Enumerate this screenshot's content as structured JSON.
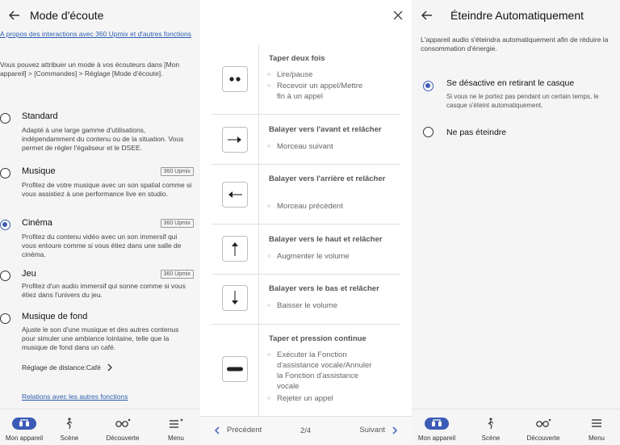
{
  "left": {
    "title": "Mode d'écoute",
    "about_link": "A propos des interactions avec 360 Upmix et d'autres fonctions",
    "intro": "Vous pouvez attribuer un mode à vos écouteurs dans [Mon appareil] > [Commandes] > Réglage [Mode d'écoute].",
    "options": [
      {
        "name": "Standard",
        "desc": "Adapté à une large gamme d'utilisations, indépendamment du contenu ou de la situation. Vous permet de régler l'égaliseur et le DSEE.",
        "badge": "",
        "selected": false
      },
      {
        "name": "Musique",
        "desc": "Profitez de votre musique avec un son spatial comme si vous assistiez à une performance live en studio.",
        "badge": "360 Upmix",
        "selected": false
      },
      {
        "name": "Cinéma",
        "desc": "Profitez du contenu vidéo avec un son immersif qui vous entoure comme si vous étiez dans une salle de cinéma.",
        "badge": "360 Upmix",
        "selected": true
      },
      {
        "name": "Jeu",
        "desc": "Profitez d'un audio immersif qui sonne comme si vous étiez dans l'univers du jeu.",
        "badge": "360 Upmix",
        "selected": false
      },
      {
        "name": "Musique de fond",
        "desc": "Ajuste le son d'une musique et des autres contenus pour simuler une ambiance lointaine, telle que la musique de fond dans un café.",
        "badge": "",
        "selected": false
      }
    ],
    "distance_setting": "Réglage de distance:Café",
    "relations_link": "Relations avec les autres fonctions"
  },
  "nav": {
    "my_device": "Mon appareil",
    "scene": "Scène",
    "discovery": "Découverte",
    "menu": "Menu"
  },
  "mid": {
    "gestures": [
      {
        "title": "Taper deux fois",
        "icon": "double-tap-icon",
        "actions": [
          "Lire/pause",
          "Recevoir un appel/Mettre fin à un appel"
        ]
      },
      {
        "title": "Balayer vers l'avant et relâcher",
        "icon": "swipe-forward-icon",
        "actions": [
          "Morceau suivant"
        ]
      },
      {
        "title": "Balayer vers l'arrière et relâcher",
        "icon": "swipe-backward-icon",
        "actions": [
          "Morceau précédent"
        ]
      },
      {
        "title": "Balayer vers le haut et relâcher",
        "icon": "swipe-up-icon",
        "actions": [
          "Augmenter le volume"
        ]
      },
      {
        "title": "Balayer vers le bas et relâcher",
        "icon": "swipe-down-icon",
        "actions": [
          "Baisser le volume"
        ]
      },
      {
        "title": "Taper et pression continue",
        "icon": "tap-hold-icon",
        "actions": [
          "Exécuter la Fonction d'assistance vocale/Annuler la Fonction d'assistance vocale",
          "Rejeter un appel"
        ]
      }
    ],
    "footer": {
      "prev": "Précédent",
      "page": "2/4",
      "next": "Suivant"
    }
  },
  "right": {
    "title": "Éteindre Automatiquement",
    "desc": "L'appareil audio s'éteindra automatiquement afin de réduire la consommation d'énergie.",
    "options": [
      {
        "name": "Se désactive en retirant le casque",
        "desc": "Si vous ne le portez pas pendant un certain temps, le casque s'éteint automatiquement.",
        "selected": true
      },
      {
        "name": "Ne pas éteindre",
        "desc": "",
        "selected": false
      }
    ]
  },
  "colors": {
    "accent": "#3b5bb5",
    "link": "#2c5fb0"
  }
}
